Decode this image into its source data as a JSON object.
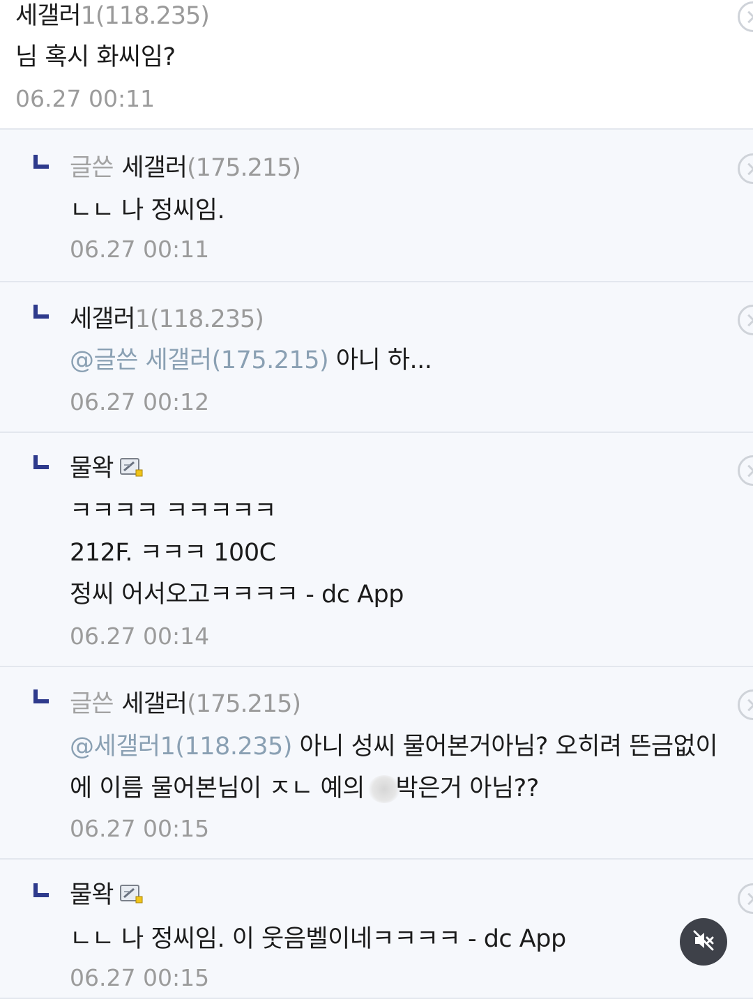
{
  "comments": [
    {
      "type": "main",
      "nick": "세갤러",
      "ip": "1(118.235)",
      "content": [
        "님 혹시 화씨임?"
      ],
      "date": "06.27 00:11"
    },
    {
      "type": "reply",
      "writer_tag": "글쓴",
      "nick": "세갤러",
      "ip": "(175.215)",
      "content": [
        "ㄴㄴ 나 정씨임."
      ],
      "date": "06.27 00:11"
    },
    {
      "type": "reply",
      "nick": "세갤러",
      "ip": "1(118.235)",
      "mention": "@글쓴 세갤러(175.215)",
      "content": [
        " 아니 하..."
      ],
      "date": "06.27 00:12"
    },
    {
      "type": "reply",
      "nick": "물왁",
      "gallog_icon": "gallog-member-icon",
      "content": [
        "ㅋㅋㅋㅋ ㅋㅋㅋㅋㅋ",
        "212F. ㅋㅋㅋ 100C",
        "정씨 어서오고ㅋㅋㅋㅋ - dc App"
      ],
      "date": "06.27 00:14"
    },
    {
      "type": "reply",
      "writer_tag": "글쓴",
      "nick": "세갤러",
      "ip": "(175.215)",
      "mention": "@세갤러1(118.235)",
      "content": [
        " 아니 성씨 물어본거아님? 오히려 뜬금없이",
        "에 이름 물어본님이 ㅈㄴ 예의 ",
        "박은거 아님??"
      ],
      "date": "06.27 00:15"
    },
    {
      "type": "reply",
      "nick": "물왁",
      "gallog_icon": "gallog-member-icon",
      "content": [
        "ㄴㄴ 나 정씨임. 이 웃음벨이네ㅋㅋㅋㅋ - dc App"
      ],
      "date": "06.27 00:15"
    }
  ],
  "colors": {
    "reply_mark": "#2e3a8c",
    "mention": "#8aa0b3",
    "ip": "#9a9a9a",
    "date": "#9b9b9b"
  },
  "video_overlay": {
    "icon": "muted-speaker-icon"
  }
}
